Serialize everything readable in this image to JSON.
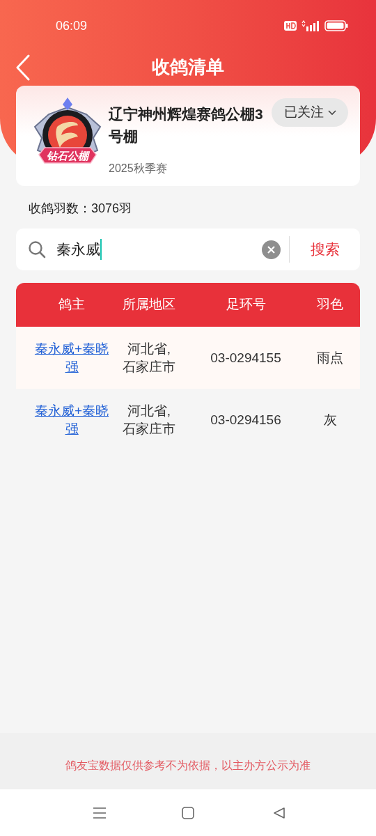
{
  "status_bar": {
    "time": "06:09"
  },
  "header": {
    "title": "收鸽清单"
  },
  "loft_card": {
    "badge_label": "钻石公棚",
    "name": "辽宁神州辉煌赛鸽公棚3号棚",
    "follow_button": {
      "label": "已关注"
    },
    "season": "2025秋季赛"
  },
  "pigeon_count": "收鸽羽数：3076羽",
  "search": {
    "value": "秦永威",
    "button": "搜索"
  },
  "table": {
    "columns": [
      "鸽主",
      "所属地区",
      "足环号",
      "羽色"
    ],
    "rows": [
      {
        "owner": "秦永威+秦晓强",
        "region": "河北省,石家庄市",
        "ring": "03-0294155",
        "feather_color": "雨点"
      },
      {
        "owner": "秦永威+秦晓强",
        "region": "河北省,石家庄市",
        "ring": "03-0294156",
        "feather_color": "灰"
      }
    ]
  },
  "footer": {
    "notice": "鸽友宝数据仅供参考不为依据，以主办方公示为准"
  }
}
